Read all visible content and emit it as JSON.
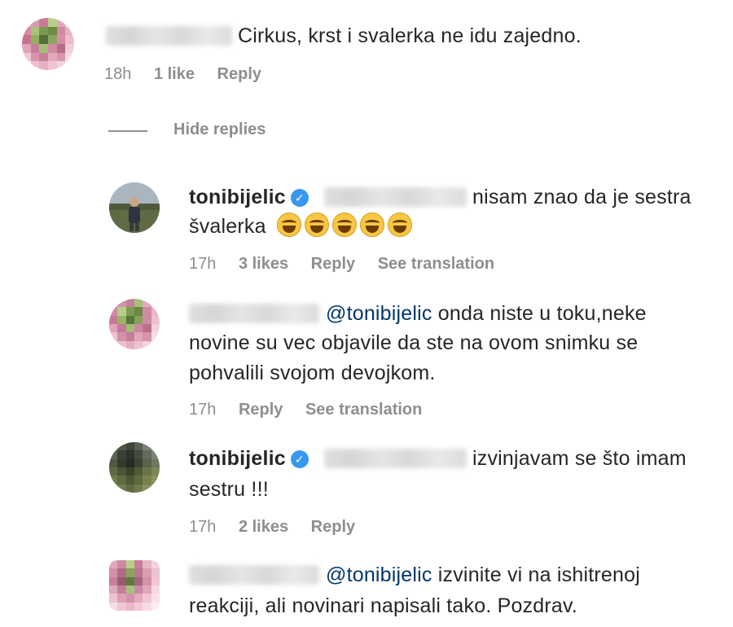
{
  "comments": [
    {
      "text": "Cirkus, krst i svalerka ne idu zajedno.",
      "time": "18h",
      "likes": "1 like",
      "reply": "Reply"
    }
  ],
  "hide_replies": "Hide replies",
  "replies": [
    {
      "username": "tonibijelic",
      "line1": "nisam znao da je sestra",
      "line2": "švalerka",
      "time": "17h",
      "likes": "3 likes",
      "reply": "Reply",
      "translate": "See translation"
    },
    {
      "mention": "@tonibijelic",
      "line1": "onda niste u toku,neke",
      "line2": "novine su vec objavile da ste na ovom snimku se",
      "line3": "pohvalili svojom devojkom.",
      "time": "17h",
      "reply": "Reply",
      "translate": "See translation"
    },
    {
      "username": "tonibijelic",
      "line1": "izvinjavam se što imam",
      "line2": "sestru !!!",
      "time": "17h",
      "likes": "2 likes",
      "reply": "Reply"
    },
    {
      "mention": "@tonibijelic",
      "line1": "izvinite vi na ishitrenoj",
      "line2": "reakciji, ali novinari napisali tako. Pozdrav."
    }
  ],
  "icons": {
    "verified": "verified-badge-icon",
    "emoji": "grinning-squinting-face-icon"
  },
  "colors": {
    "text": "#262626",
    "meta": "#8e8e8e",
    "mention": "#00376b",
    "verified": "#3897f0"
  }
}
